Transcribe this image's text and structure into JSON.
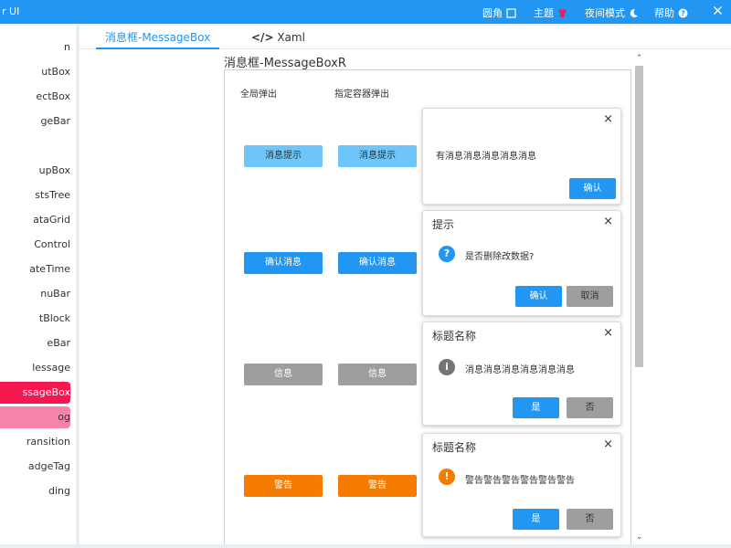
{
  "titlebar": {
    "app_title": "r UI",
    "corner_label": "圆角",
    "theme_label": "主题",
    "night_label": "夜间模式",
    "help_label": "帮助",
    "icons": {
      "corner": "square-icon",
      "theme": "tshirt-icon",
      "night": "moon-icon",
      "help": "help-circle-icon"
    },
    "theme_color": "#e91e63"
  },
  "sidebar": {
    "items": [
      {
        "label": "n"
      },
      {
        "label": "utBox"
      },
      {
        "label": "ectBox"
      },
      {
        "label": "geBar"
      },
      {
        "label": ""
      },
      {
        "label": "upBox"
      },
      {
        "label": "stsTree"
      },
      {
        "label": "ataGrid"
      },
      {
        "label": "Control"
      },
      {
        "label": "ateTime"
      },
      {
        "label": "nuBar"
      },
      {
        "label": "tBlock"
      },
      {
        "label": "eBar"
      },
      {
        "label": "lessage"
      },
      {
        "label": "ssageBox",
        "state": "active"
      },
      {
        "label": "og",
        "state": "hover"
      },
      {
        "label": "ransition"
      },
      {
        "label": "adgeTag"
      },
      {
        "label": "ding"
      }
    ]
  },
  "tabs": {
    "demo_label": "消息框-MessageBox",
    "xaml_label": "Xaml",
    "xaml_icon": "code-icon"
  },
  "page": {
    "title": "消息框-MessageBoxR",
    "col_global": "全局弹出",
    "col_container": "指定容器弹出"
  },
  "buttons": {
    "info": "消息提示",
    "confirm": "确认消息",
    "message": "信息",
    "warning": "警告"
  },
  "dialogs": {
    "info": {
      "message": "有消息消息消息消息消息",
      "ok": "确认"
    },
    "confirm": {
      "title": "提示",
      "message": "是否删除改数据?",
      "ok": "确认",
      "cancel": "取消",
      "icon": "question-icon"
    },
    "message": {
      "title": "标题名称",
      "message": "消息消息消息消息消息消息",
      "yes": "是",
      "no": "否",
      "icon": "info-icon"
    },
    "warning": {
      "title": "标题名称",
      "message": "警告警告警告警告警告警告",
      "yes": "是",
      "no": "否",
      "icon": "warning-icon"
    }
  },
  "colors": {
    "primary": "#2196f3",
    "light_blue": "#6ec6f8",
    "gray": "#9e9e9e",
    "warning": "#f57c00",
    "active_nav": "#f5174f",
    "hover_nav": "#f784a8"
  }
}
